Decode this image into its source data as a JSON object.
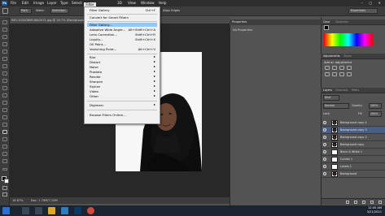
{
  "app": {
    "logo": "Ps",
    "menus": [
      "File",
      "Edit",
      "Image",
      "Layer",
      "Type",
      "Select",
      "Filter",
      "3D",
      "View",
      "Window",
      "Help"
    ],
    "window_controls": "–  ▢  ✕"
  },
  "options_bar": {
    "style_label": "Path",
    "mode_label": "Make:",
    "selection_label": "Selection...",
    "align_edges": "Align Edges",
    "workspace": "Essentials"
  },
  "document": {
    "tab_title": "IMG-20200806-WA0011.jpg @ 16.7% (Background copy 4, RGB/8#) *",
    "zoom": "16.67%",
    "doc_info": "Doc: 1.79M/7.19M"
  },
  "filter_menu": {
    "title": "Filter",
    "last_filter": {
      "label": "Filter Gallery",
      "shortcut": "Ctrl+F"
    },
    "smart": "Convert for Smart Filters",
    "items": [
      {
        "label": "Filter Gallery...",
        "shortcut": ""
      },
      {
        "label": "Adaptive Wide Angle...",
        "shortcut": "Alt+Shift+Ctrl+A"
      },
      {
        "label": "Lens Correction...",
        "shortcut": "Shift+Ctrl+R"
      },
      {
        "label": "Liquify...",
        "shortcut": "Shift+Ctrl+X"
      },
      {
        "label": "Oil Paint...",
        "shortcut": ""
      },
      {
        "label": "Vanishing Point...",
        "shortcut": "Alt+Ctrl+V"
      }
    ],
    "submenus": [
      "Blur",
      "Distort",
      "Noise",
      "Pixelate",
      "Render",
      "Sharpen",
      "Stylize",
      "Video",
      "Other"
    ],
    "digimarc": "Digimarc",
    "browse": "Browse Filters Online..."
  },
  "properties_panel": {
    "tab": "Properties",
    "empty_text": "No Properties"
  },
  "color_panel": {
    "tabs": [
      "Color",
      "Swatches"
    ]
  },
  "adjustments_panel": {
    "tabs": [
      "Adjustments",
      "Styles"
    ],
    "title": "Add an adjustment"
  },
  "layers_panel": {
    "tabs": [
      "Layers",
      "Channels",
      "Paths"
    ],
    "kind": "Kind",
    "blend_mode": "Normal",
    "opacity_label": "Opacity:",
    "opacity_value": "100%",
    "lock_label": "Lock:",
    "fill_label": "Fill:",
    "fill_value": "100%",
    "layers": [
      {
        "name": "Background copy 4",
        "selected": false
      },
      {
        "name": "Background copy 3",
        "selected": true
      },
      {
        "name": "Background copy 2",
        "selected": false
      },
      {
        "name": "Background copy",
        "selected": false
      },
      {
        "name": "Black & White 1",
        "selected": false
      },
      {
        "name": "Curves 1",
        "selected": false
      },
      {
        "name": "Levels 1",
        "selected": false
      },
      {
        "name": "Background",
        "selected": false
      }
    ]
  },
  "taskbar": {
    "time": "12:00 AM",
    "date": "3/21/2021"
  }
}
